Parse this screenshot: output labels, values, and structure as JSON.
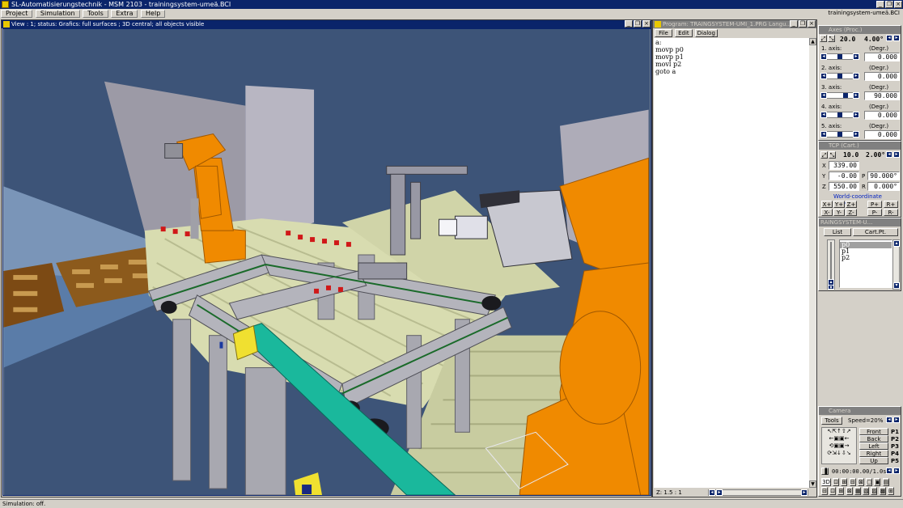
{
  "app": {
    "title": "SL-Automatisierungstechnik - MSM 2103 - trainingsystem-umeä.BCI",
    "right_label": "trainingsystem-umeä.BCI",
    "status": "Simulation: off."
  },
  "menu": [
    "Project",
    "Simulation",
    "Tools",
    "Extra",
    "Help"
  ],
  "view": {
    "title": "View  : 1;  status: Grafics:  full surfaces ; 3D central; all objects visible"
  },
  "program": {
    "title": "Program: TRAINGSYSTEM-UMI_1.PRG Langu...",
    "menu": [
      "File",
      "Edit",
      "Dialog"
    ],
    "lines": [
      "a:",
      "movp p0",
      "movp p1",
      "movl p2",
      "goto a"
    ],
    "zoom": "Z: 1.5 : 1"
  },
  "axes": {
    "title": "Axes (Proc.)",
    "step1": "20.0",
    "step2": "4.00°",
    "list": [
      {
        "name": "1. axis:",
        "unit": "(Degr.)",
        "value": "0.000",
        "pos": 0.45
      },
      {
        "name": "2. axis:",
        "unit": "(Degr.)",
        "value": "0.000",
        "pos": 0.45
      },
      {
        "name": "3. axis:",
        "unit": "(Degr.)",
        "value": "90.000",
        "pos": 0.72
      },
      {
        "name": "4. axis:",
        "unit": "(Degr.)",
        "value": "0.000",
        "pos": 0.45
      },
      {
        "name": "5. axis:",
        "unit": "(Degr.)",
        "value": "0.000",
        "pos": 0.45
      }
    ]
  },
  "tcp": {
    "title": "TCP (Cart.)",
    "step1": "10.0",
    "step2": "2.00°",
    "x_label": "X",
    "x": "339.00",
    "y_label": "Y",
    "y": "-0.00",
    "p_label": "P",
    "p": "90.000°",
    "z_label": "Z",
    "z": "550.00",
    "r_label": "R",
    "r": "0.000°",
    "coord_system": "World-coordinate system",
    "jog": [
      [
        "X+",
        "Y+",
        "Z+",
        "P+",
        "R+"
      ],
      [
        "X-",
        "Y-",
        "Z-",
        "P-",
        "R-"
      ]
    ]
  },
  "points": {
    "title": "RAINGSYSTEM-U...",
    "tabs": [
      "List",
      "Cart.Pt."
    ],
    "items": [
      "p0",
      "p1",
      "p2"
    ]
  },
  "camera": {
    "title": "Camera",
    "tools": "Tools",
    "speed": "Speed=20%",
    "views": [
      {
        "label": "Front",
        "key": "P1"
      },
      {
        "label": "Back",
        "key": "P2"
      },
      {
        "label": "Left",
        "key": "P3"
      },
      {
        "label": "Right",
        "key": "P4"
      },
      {
        "label": "Up",
        "key": "P5"
      }
    ],
    "time": "00:00:00.00/1.0s",
    "mode": "3D"
  },
  "colors": {
    "title_active": "#0a246a",
    "face": "#d4d0c8",
    "scene_bg": "#3d5478",
    "robot_orange": "#f08a00",
    "conveyor_teal": "#1ab89c"
  }
}
